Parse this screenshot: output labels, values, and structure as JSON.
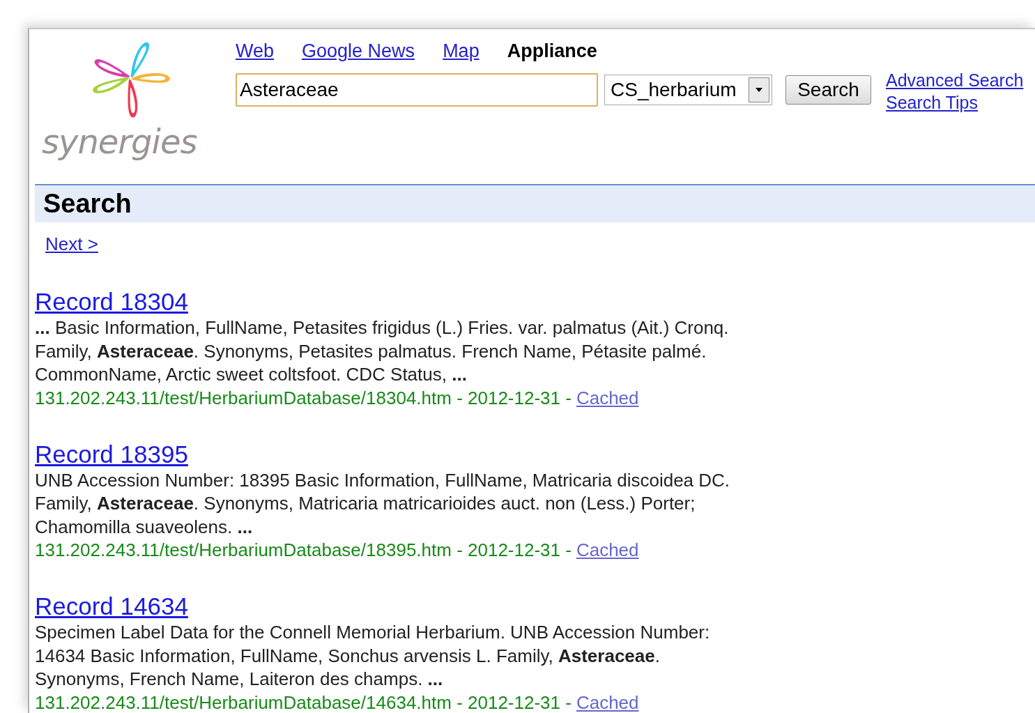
{
  "logo": {
    "text": "synergies"
  },
  "tabs": [
    {
      "label": "Web",
      "selected": false
    },
    {
      "label": "Google News",
      "selected": false
    },
    {
      "label": "Map",
      "selected": false
    },
    {
      "label": "Appliance",
      "selected": true
    }
  ],
  "search": {
    "value": "Asteraceae",
    "collection": "CS_herbarium",
    "button": "Search"
  },
  "links": [
    "Advanced Search",
    "Search Tips"
  ],
  "header": {
    "title": "Search"
  },
  "pager": {
    "next": "Next >"
  },
  "results": [
    {
      "title": "Record 18304",
      "snippet": "**...** Basic Information, FullName, Petasites frigidus (L.) Fries. var. palmatus (Ait.) Cronq. Family, **Asteraceae**. Synonyms, Petasites palmatus. French Name, Pétasite palmé. CommonName, Arctic sweet coltsfoot. CDC Status, **...**",
      "url": "131.202.243.11/test/HerbariumDatabase/18304.htm - 2012-12-31 -",
      "cached": "Cached"
    },
    {
      "title": "Record 18395",
      "snippet": "UNB Accession Number: 18395 Basic Information, FullName, Matricaria discoidea DC. Family, **Asteraceae**. Synonyms, Matricaria matricarioides auct. non (Less.) Porter; Chamomilla suaveolens. **...**",
      "url": "131.202.243.11/test/HerbariumDatabase/18395.htm - 2012-12-31 -",
      "cached": "Cached"
    },
    {
      "title": "Record 14634",
      "snippet": "Specimen Label Data for the Connell Memorial Herbarium. UNB Accession Number: 14634 Basic Information, FullName, Sonchus arvensis L. Family, **Asteraceae**. Synonyms, French Name, Laiteron des champs. **...**",
      "url": "131.202.243.11/test/HerbariumDatabase/14634.htm - 2012-12-31 -",
      "cached": "Cached"
    }
  ]
}
